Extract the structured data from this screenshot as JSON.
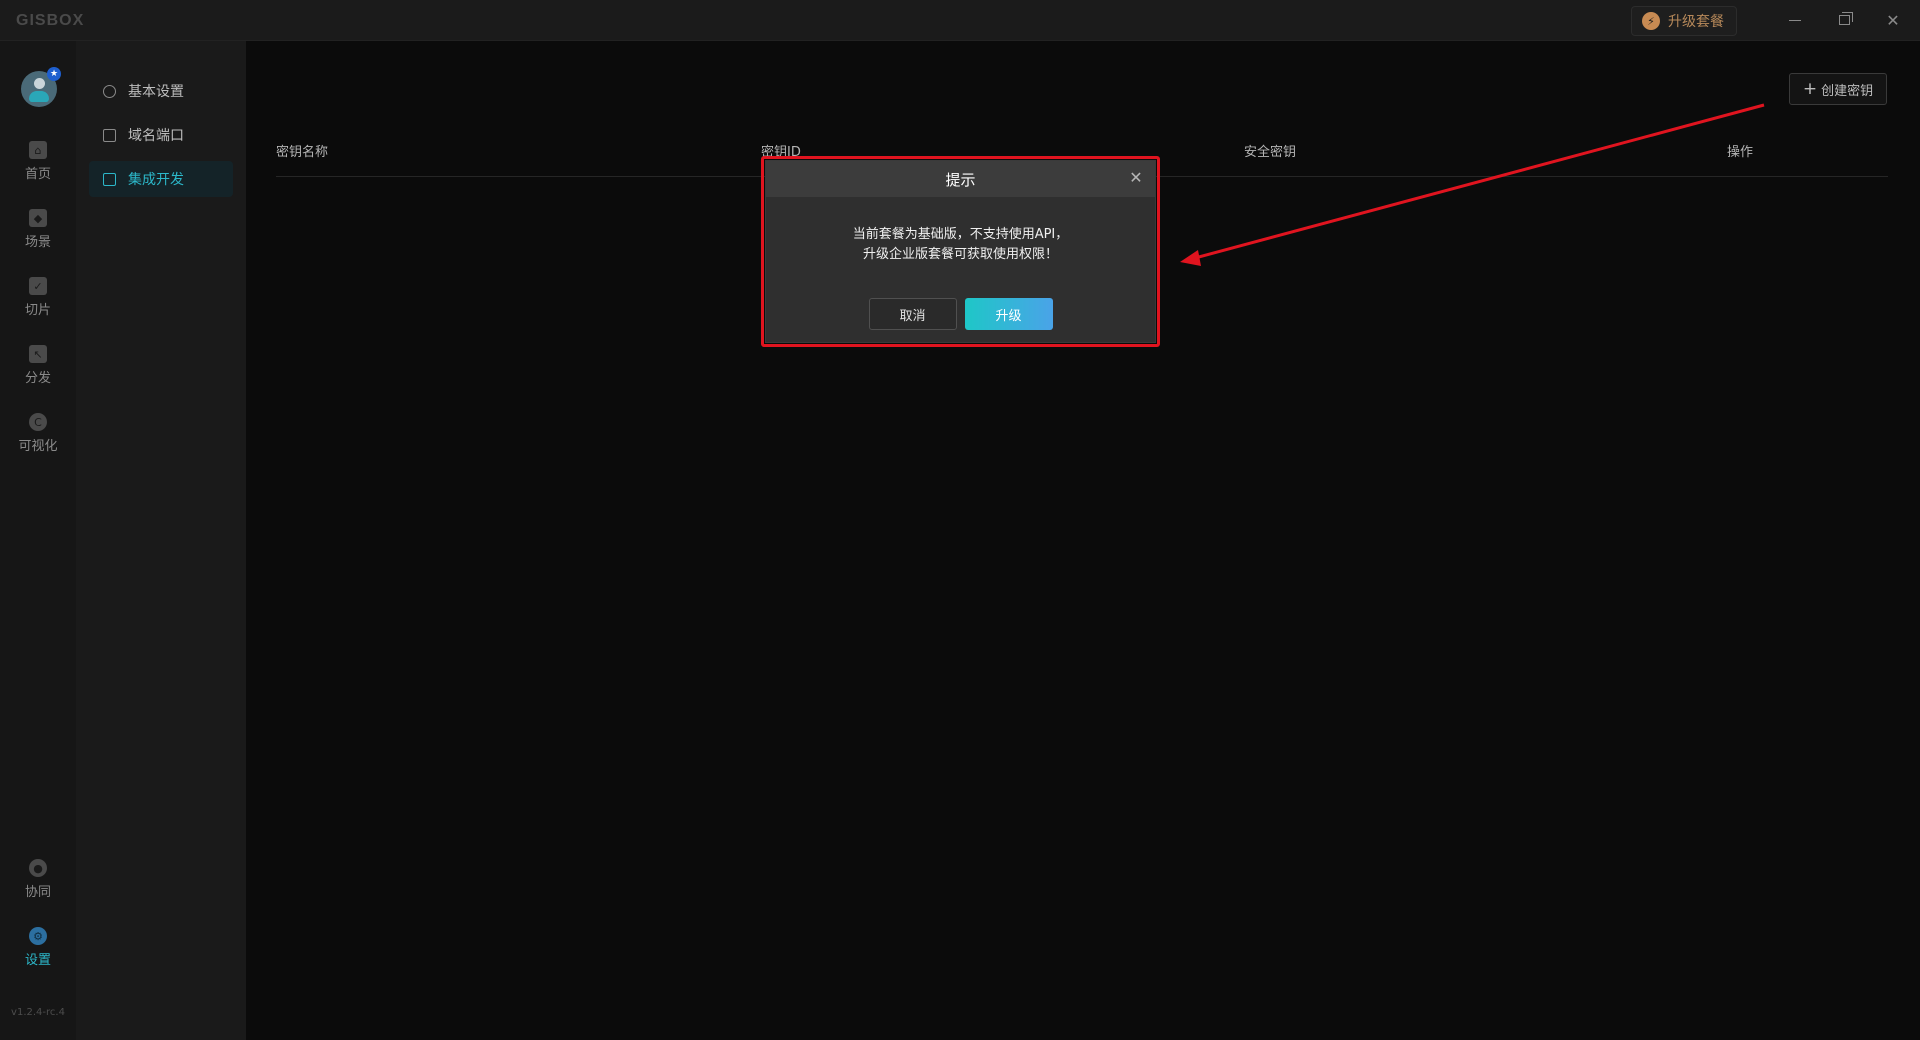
{
  "app": {
    "logo": "GISBOX"
  },
  "titlebar": {
    "upgrade_plan_label": "升级套餐",
    "upgrade_icon_glyph": "⚡",
    "close_glyph": "✕"
  },
  "avatar": {
    "badge_glyph": "★"
  },
  "leftnav": {
    "items": [
      {
        "label": "首页",
        "icon": "home-icon"
      },
      {
        "label": "场景",
        "icon": "cube-icon"
      },
      {
        "label": "切片",
        "icon": "slice-icon"
      },
      {
        "label": "分发",
        "icon": "distribute-icon"
      },
      {
        "label": "可视化",
        "icon": "visualization-icon"
      }
    ],
    "bottom_items": [
      {
        "label": "协同",
        "icon": "lock-icon"
      },
      {
        "label": "设置",
        "icon": "settings-icon"
      }
    ],
    "version": "v1.2.4-rc.4"
  },
  "subnav": {
    "items": [
      {
        "label": "基本设置",
        "icon": "gear-icon"
      },
      {
        "label": "域名端口",
        "icon": "document-icon"
      },
      {
        "label": "集成开发",
        "icon": "folder-icon",
        "active": true
      }
    ]
  },
  "content": {
    "create_key_label": "创建密钥",
    "table_columns": [
      "密钥名称",
      "密钥ID",
      "安全密钥",
      "操作"
    ]
  },
  "dialog": {
    "title": "提示",
    "close_glyph": "✕",
    "message_line1": "当前套餐为基础版，不支持使用API，",
    "message_line2": "升级企业版套餐可获取使用权限！",
    "cancel_label": "取消",
    "upgrade_label": "升级"
  },
  "annotation": {
    "color": "#e0141f"
  },
  "colors": {
    "accent": "#2cb7c9",
    "upgrade_gradient_start": "#1ec7c7",
    "upgrade_gradient_end": "#4aa3e8"
  }
}
